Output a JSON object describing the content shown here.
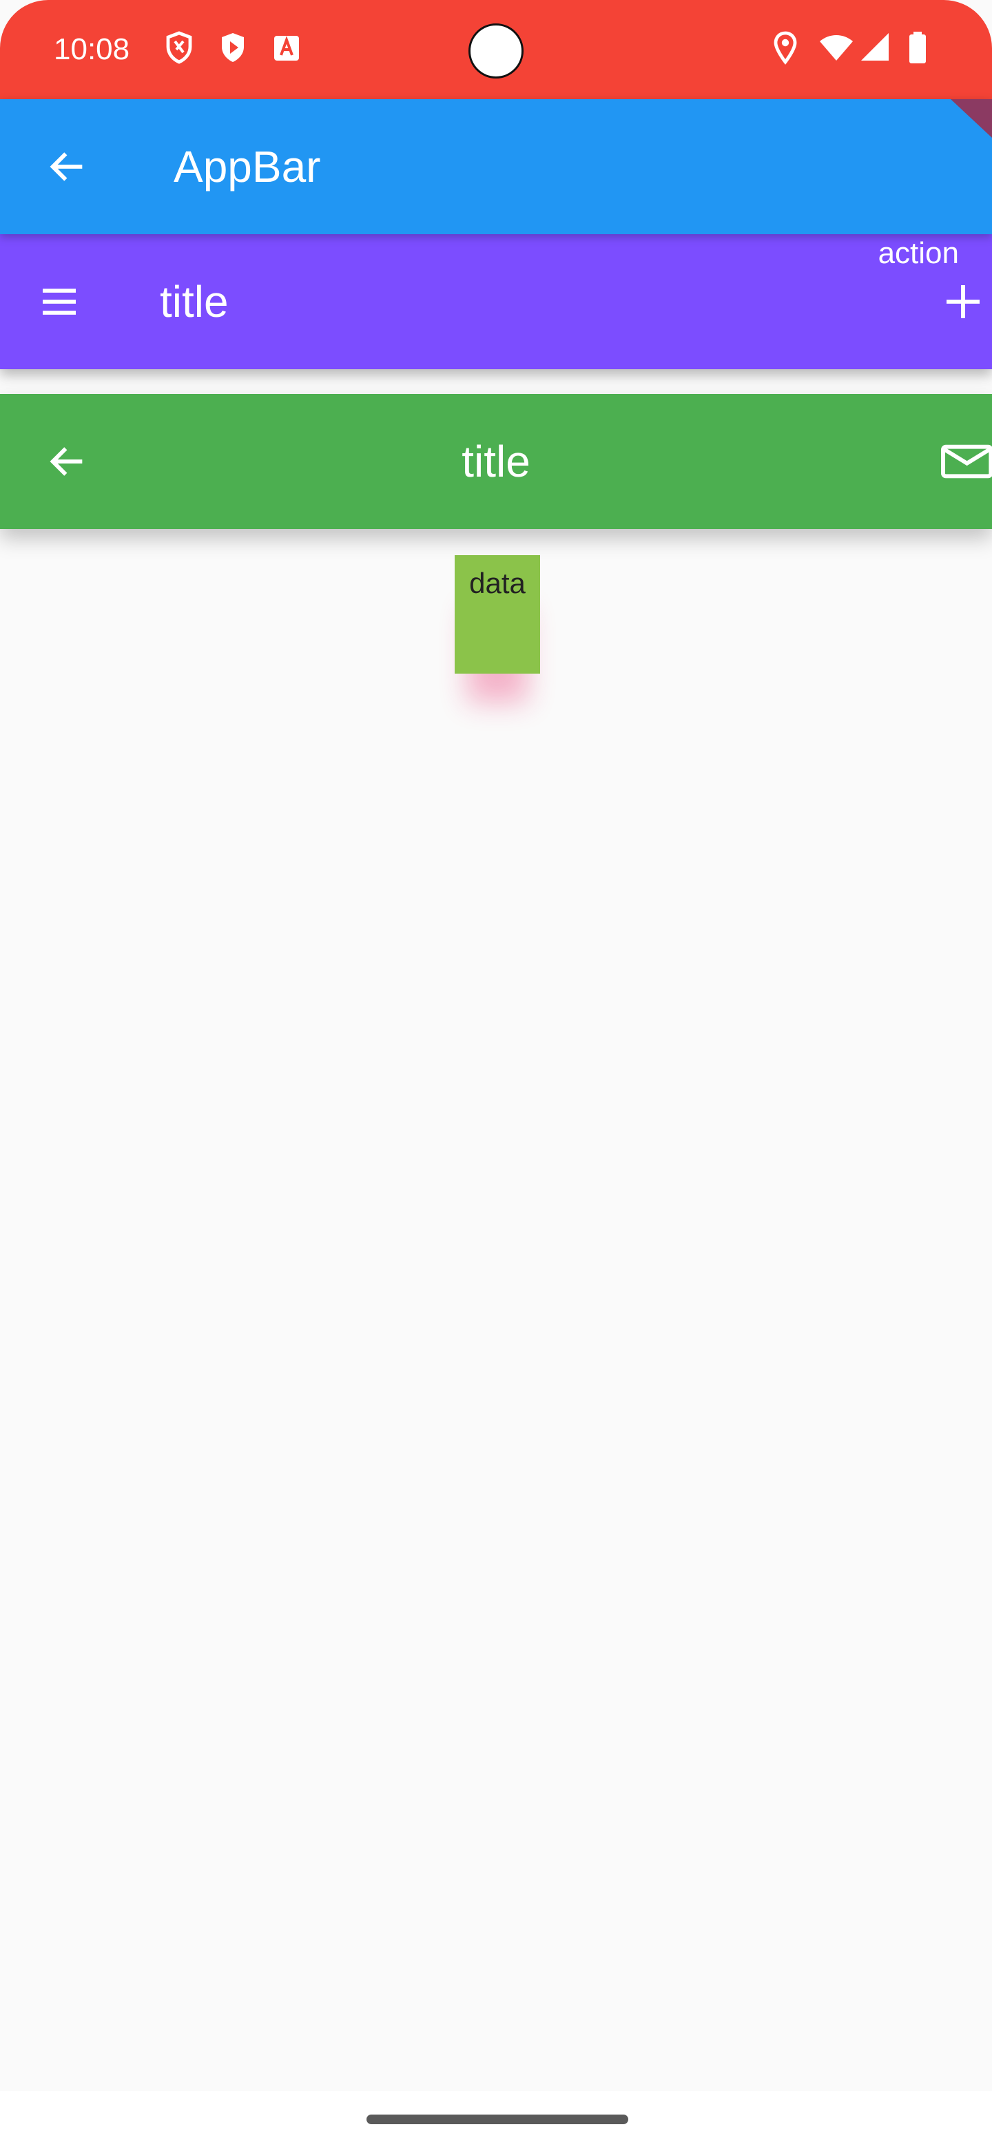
{
  "status_bar": {
    "time": "10:08",
    "left_icons": [
      "shield-icon",
      "play-protect-icon",
      "autofill-icon"
    ],
    "right_icons": [
      "location-icon",
      "wifi-icon",
      "signal-icon",
      "battery-icon"
    ]
  },
  "appbar_main": {
    "title": "AppBar",
    "leading_icon": "back-arrow-icon",
    "color": "#2196f3"
  },
  "appbar_purple": {
    "title": "title",
    "leading_icon": "menu-icon",
    "action_label": "action",
    "action_icon": "add-icon",
    "color": "#7c4dff"
  },
  "appbar_green": {
    "title": "title",
    "leading_icon": "back-arrow-icon",
    "action_icon": "mail-icon",
    "color": "#4caf50"
  },
  "content": {
    "data_label": "data",
    "box_color": "#8bc34a"
  },
  "colors": {
    "status_bar": "#f44336",
    "background": "#fafafa"
  }
}
